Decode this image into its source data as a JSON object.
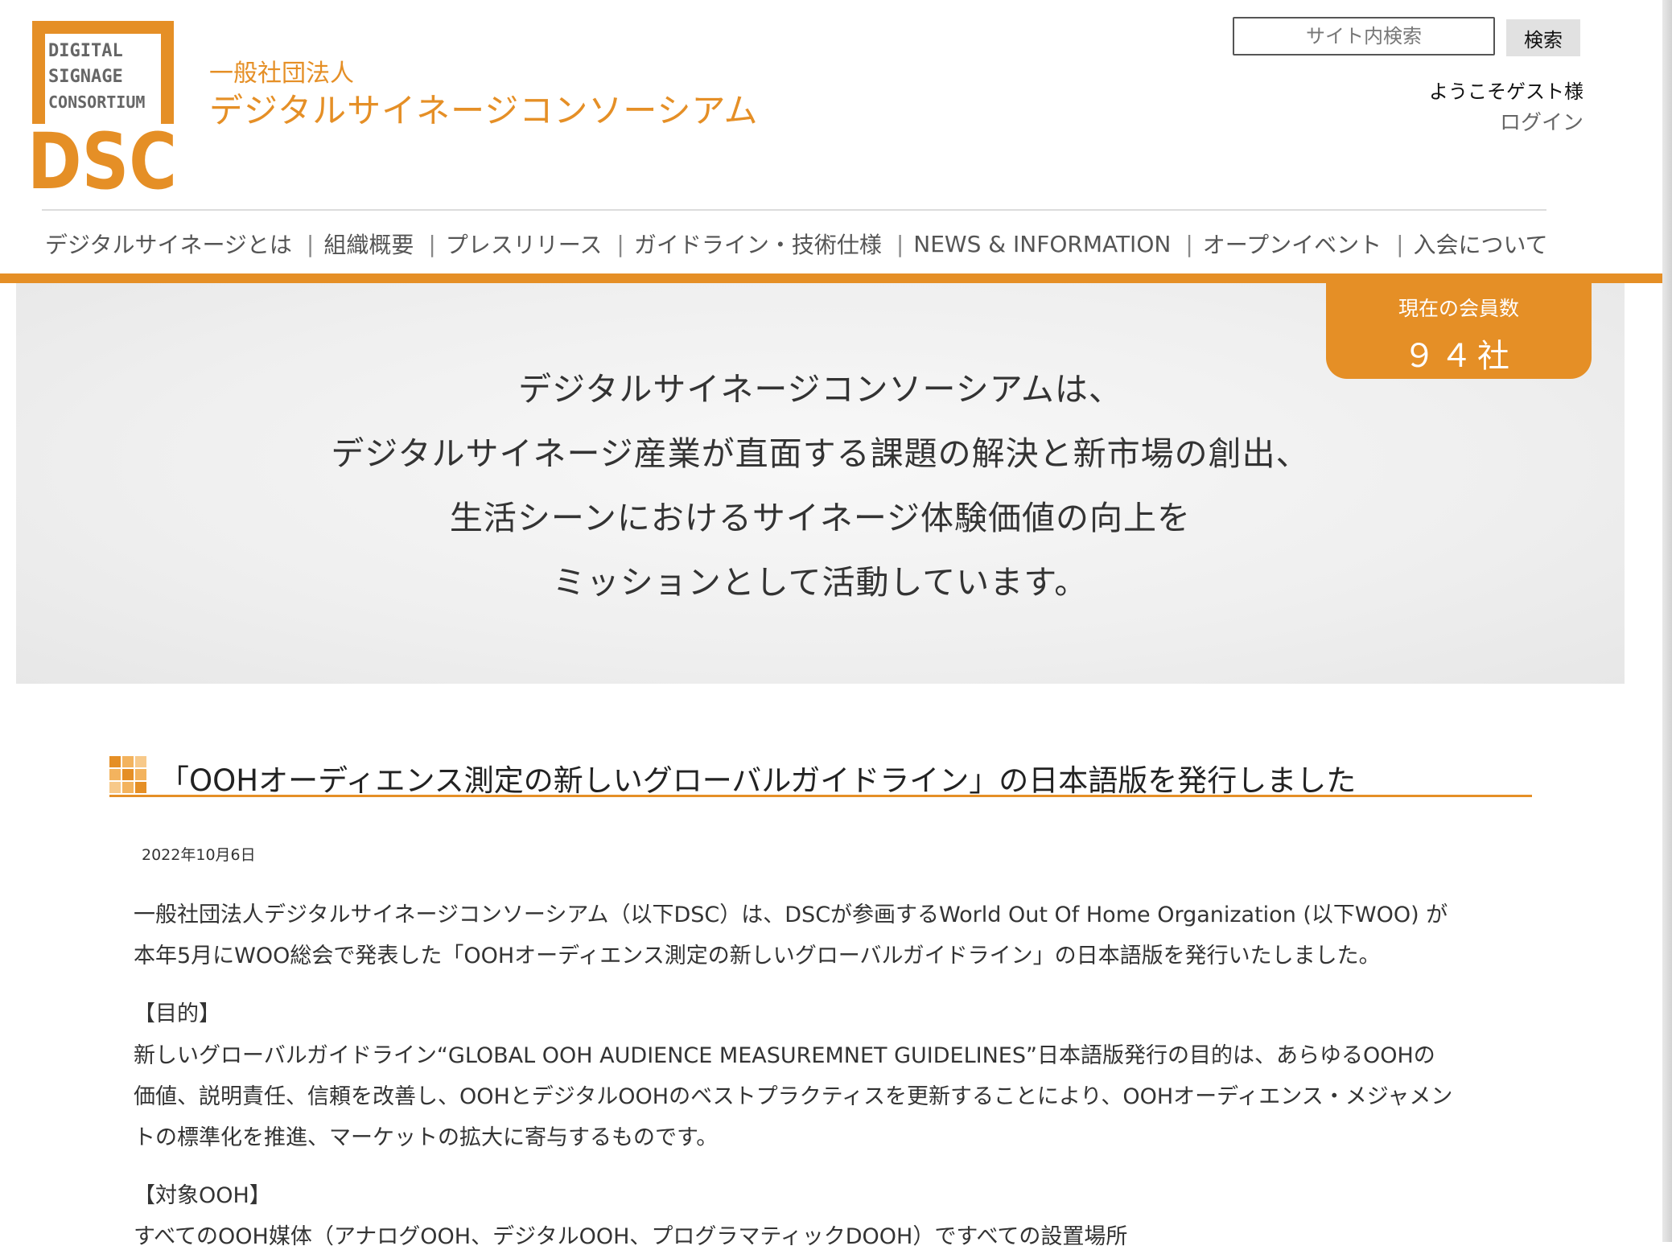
{
  "header": {
    "logo_lines": [
      "DIGITAL",
      "SIGNAGE",
      "CONSORTIUM"
    ],
    "logo_mark": "DSC",
    "org_type": "一般社団法人",
    "org_name": "デジタルサイネージコンソーシアム",
    "search_placeholder": "サイト内検索",
    "search_button": "検索",
    "welcome": "ようこそゲスト様",
    "login": "ログイン"
  },
  "nav": {
    "items": [
      "デジタルサイネージとは",
      "組織概要",
      "プレスリリース",
      "ガイドライン・技術仕様",
      "NEWS & INFORMATION",
      "オープンイベント",
      "入会について"
    ],
    "separator": "|"
  },
  "hero": {
    "lines": [
      "デジタルサイネージコンソーシアムは、",
      "デジタルサイネージ産業が直面する課題の解決と新市場の創出、",
      "生活シーンにおけるサイネージ体験価値の向上を",
      "ミッションとして活動しています。"
    ],
    "member_label": "現在の会員数",
    "member_count": "９４社"
  },
  "article": {
    "title": "「OOHオーディエンス測定の新しいグローバルガイドライン」の日本語版を発行しました",
    "date": "2022年10月6日",
    "p1": [
      "一般社団法人デジタルサイネージコンソーシアム（以下DSC）は、DSCが参画するWorld Out Of Home Organization (以下WOO) が",
      "本年5月にWOO総会で発表した「OOHオーディエンス測定の新しいグローバルガイドライン」の日本語版を発行いたしました。"
    ],
    "h_purpose": "【目的】",
    "p2": [
      "新しいグローバルガイドライン“GLOBAL OOH AUDIENCE MEASUREMNET GUIDELINES”日本語版発行の目的は、あらゆるOOHの",
      "価値、説明責任、信頼を改善し、OOHとデジタルOOHのベストプラクティスを更新することにより、OOHオーディエンス・メジャメン",
      "トの標準化を推進、マーケットの拡大に寄与するものです。"
    ],
    "h_target": "【対象OOH】",
    "p3": "すべてのOOH媒体（アナログOOH、デジタルOOH、プログラマティックDOOH）ですべての設置場所"
  },
  "colors": {
    "brand_orange": "#e58f26",
    "hero_bg": "#efefef",
    "text": "#333333"
  }
}
